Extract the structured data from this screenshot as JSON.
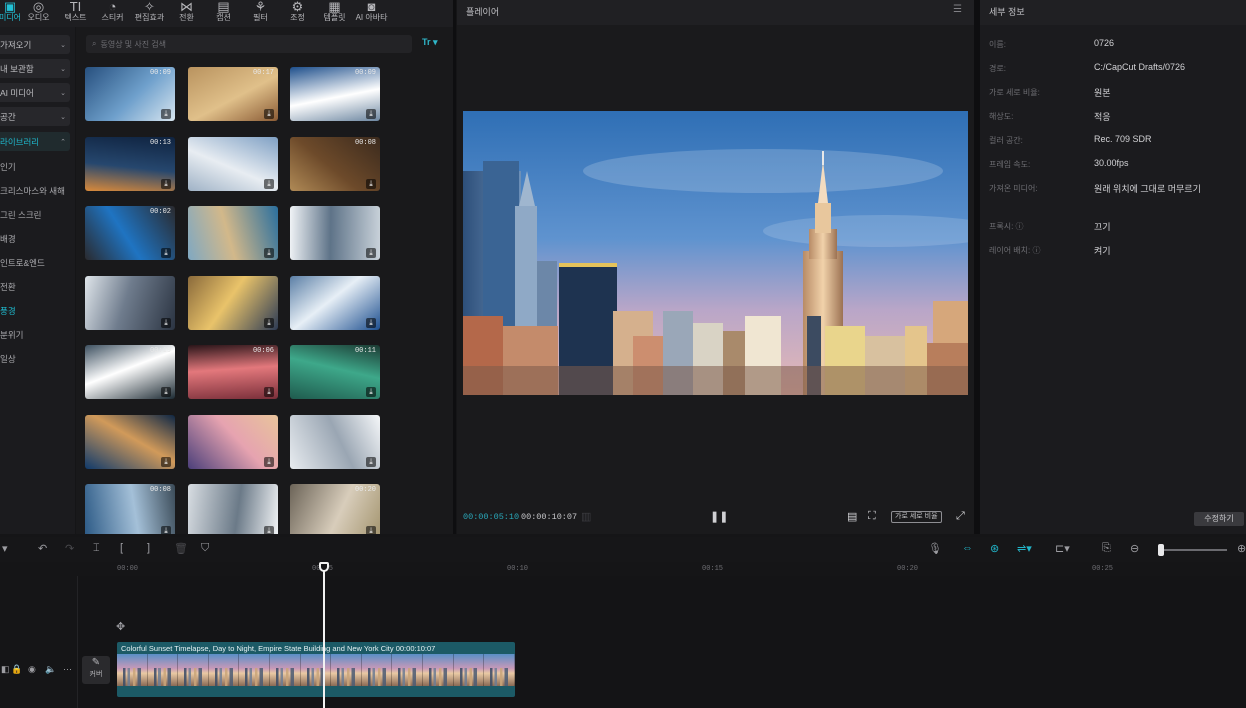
{
  "toolbar": {
    "tools": [
      {
        "label": "미디어",
        "icon": "media-icon",
        "glyph": "▣"
      },
      {
        "label": "오디오",
        "icon": "audio-icon",
        "glyph": "◎"
      },
      {
        "label": "텍스트",
        "icon": "text-icon",
        "glyph": "TI"
      },
      {
        "label": "스티커",
        "icon": "sticker-icon",
        "glyph": "◔"
      },
      {
        "label": "편집효과",
        "icon": "effects-icon",
        "glyph": "✧"
      },
      {
        "label": "전환",
        "icon": "transition-icon",
        "glyph": "⋈"
      },
      {
        "label": "캡션",
        "icon": "caption-icon",
        "glyph": "▤"
      },
      {
        "label": "필터",
        "icon": "filter-icon",
        "glyph": "⚘"
      },
      {
        "label": "조정",
        "icon": "adjust-icon",
        "glyph": "⚙"
      },
      {
        "label": "템플릿",
        "icon": "template-icon",
        "glyph": "▦"
      },
      {
        "label": "AI 아바타",
        "icon": "ai-avatar-icon",
        "glyph": "◙"
      }
    ]
  },
  "categories": {
    "dropdowns": [
      "가져오기",
      "내 보관함",
      "AI 미디어",
      "공간",
      "라이브러리"
    ],
    "items": [
      "인기",
      "크리스마스와 새해",
      "그린 스크린",
      "배경",
      "인트로&엔드",
      "전환",
      "풍경",
      "분위기",
      "일상"
    ],
    "active_item": "풍경"
  },
  "media": {
    "search_placeholder": "동영상 및 사진 검색",
    "filter_label": "Tr ▾",
    "thumbnails": [
      {
        "duration": "00:09"
      },
      {
        "duration": "00:17"
      },
      {
        "duration": "00:09"
      },
      {
        "duration": "00:13"
      },
      {
        "duration": ""
      },
      {
        "duration": "00:08"
      },
      {
        "duration": "00:02"
      },
      {
        "duration": ""
      },
      {
        "duration": ""
      },
      {
        "duration": ""
      },
      {
        "duration": ""
      },
      {
        "duration": ""
      },
      {
        "duration": "00:19"
      },
      {
        "duration": "00:06"
      },
      {
        "duration": "00:11"
      },
      {
        "duration": ""
      },
      {
        "duration": ""
      },
      {
        "duration": ""
      },
      {
        "duration": "00:08"
      },
      {
        "duration": ""
      },
      {
        "duration": "00:20"
      }
    ]
  },
  "player": {
    "title": "플레이어",
    "current_time": "00:00:05:10",
    "total_time": "00:00:10:07",
    "ratio_label": "가로 세로 비율"
  },
  "details": {
    "title": "세부 정보",
    "fields": [
      {
        "label": "이름:",
        "value": "0726"
      },
      {
        "label": "경로:",
        "value": "C:/CapCut Drafts/0726"
      },
      {
        "label": "가로 세로 비율:",
        "value": "원본"
      },
      {
        "label": "해상도:",
        "value": "적응"
      },
      {
        "label": "컬러 공간:",
        "value": "Rec. 709 SDR"
      },
      {
        "label": "프레임 속도:",
        "value": "30.00fps"
      },
      {
        "label": "가져온 미디어:",
        "value": "원래 위치에 그대로 머무르기"
      },
      {
        "label": "프록시: ⓘ",
        "value": "끄기"
      },
      {
        "label": "레이어 배치: ⓘ",
        "value": "켜기"
      }
    ],
    "edit_button": "수정하기"
  },
  "timeline": {
    "ticks": [
      "00:00",
      "00:05",
      "00:10",
      "00:15",
      "00:20",
      "00:25"
    ],
    "clip_label": "Colorful Sunset Timelapse, Day to Night, Empire State Building and New York City  00:00:10:07",
    "cover_label": "커버"
  }
}
